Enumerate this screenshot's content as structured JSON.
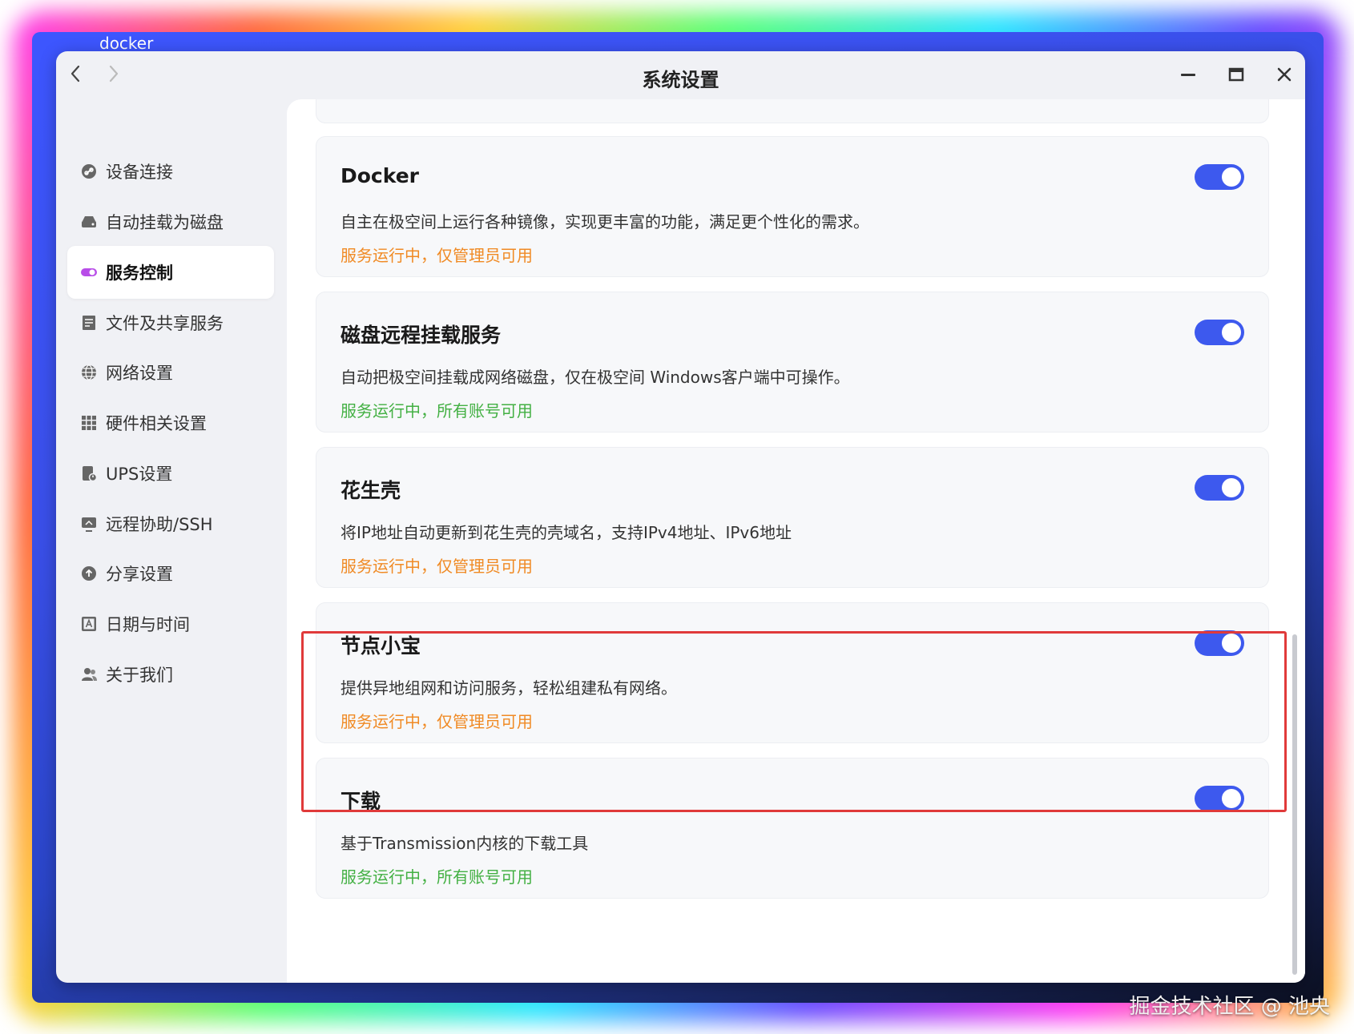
{
  "desktop": {
    "window_label": "docker",
    "watermark": "掘金技术社区 @ 池央"
  },
  "window": {
    "title": "系统设置",
    "back_icon": "chevron-left-icon",
    "forward_icon": "chevron-right-icon",
    "controls": [
      "minimize-icon",
      "maximize-icon",
      "close-icon"
    ]
  },
  "sidebar": {
    "items": [
      {
        "label": "设备连接",
        "icon": "link-icon",
        "active": false
      },
      {
        "label": "自动挂载为磁盘",
        "icon": "disk-icon",
        "active": false
      },
      {
        "label": "服务控制",
        "icon": "toggle-icon",
        "active": true
      },
      {
        "label": "文件及共享服务",
        "icon": "file-share-icon",
        "active": false
      },
      {
        "label": "网络设置",
        "icon": "globe-icon",
        "active": false
      },
      {
        "label": "硬件相关设置",
        "icon": "grid-icon",
        "active": false
      },
      {
        "label": "UPS设置",
        "icon": "ups-icon",
        "active": false
      },
      {
        "label": "远程协助/SSH",
        "icon": "monitor-icon",
        "active": false
      },
      {
        "label": "分享设置",
        "icon": "share-icon",
        "active": false
      },
      {
        "label": "日期与时间",
        "icon": "calendar-icon",
        "active": false
      },
      {
        "label": "关于我们",
        "icon": "users-icon",
        "active": false
      }
    ]
  },
  "services": [
    {
      "title": "Docker",
      "description": "自主在极空间上运行各种镜像，实现更丰富的功能，满足更个性化的需求。",
      "status": "服务运行中，仅管理员可用",
      "status_color": "#f08a24",
      "enabled": true
    },
    {
      "title": "磁盘远程挂载服务",
      "description": "自动把极空间挂载成网络磁盘，仅在极空间 Windows客户端中可操作。",
      "status": "服务运行中，所有账号可用",
      "status_color": "#43b043",
      "enabled": true
    },
    {
      "title": "花生壳",
      "description": "将IP地址自动更新到花生壳的壳域名，支持IPv4地址、IPv6地址",
      "status": "服务运行中，仅管理员可用",
      "status_color": "#f08a24",
      "enabled": true
    },
    {
      "title": "节点小宝",
      "description": "提供异地组网和访问服务，轻松组建私有网络。",
      "status": "服务运行中，仅管理员可用",
      "status_color": "#f08a24",
      "enabled": true
    },
    {
      "title": "下载",
      "description": "基于Transmission内核的下载工具",
      "status": "服务运行中，所有账号可用",
      "status_color": "#43b043",
      "enabled": true
    }
  ],
  "accent_color": "#3d59ee",
  "highlight_color": "#e03a3a"
}
